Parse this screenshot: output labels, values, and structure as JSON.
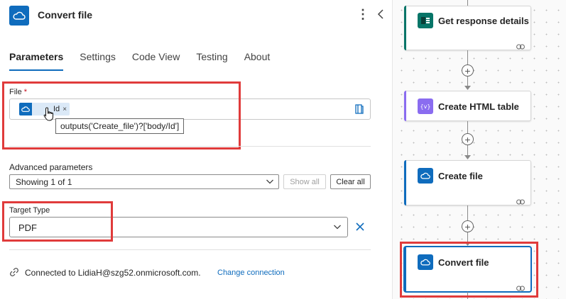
{
  "panel": {
    "title": "Convert file",
    "tabs": [
      {
        "label": "Parameters",
        "active": true
      },
      {
        "label": "Settings",
        "active": false
      },
      {
        "label": "Code View",
        "active": false
      },
      {
        "label": "Testing",
        "active": false
      },
      {
        "label": "About",
        "active": false
      }
    ],
    "file_field": {
      "label": "File",
      "required_mark": "*",
      "token_text": "Id",
      "token_remove": "×",
      "tooltip": "outputs('Create_file')?['body/Id']"
    },
    "advanced": {
      "label": "Advanced parameters",
      "selected": "Showing 1 of 1",
      "show_all": "Show all",
      "clear_all": "Clear all"
    },
    "target_type": {
      "label": "Target Type",
      "value": "PDF"
    },
    "connection": {
      "text": "Connected to LidiaH@szg52.onmicrosoft.com.",
      "link": "Change connection"
    }
  },
  "flow": {
    "add_symbol": "+",
    "cards": [
      {
        "title": "Get response details",
        "icon": "forms-icon",
        "color": "#077568"
      },
      {
        "title": "Create HTML table",
        "icon": "data-operation-icon",
        "color": "#8a6cf0"
      },
      {
        "title": "Create file",
        "icon": "onedrive-icon",
        "color": "#0f6cbd"
      },
      {
        "title": "Convert file",
        "icon": "onedrive-icon",
        "color": "#0f6cbd",
        "selected": true
      }
    ]
  },
  "colors": {
    "accent": "#0f6cbd",
    "highlight": "#e03b3b",
    "required": "#c50f1f"
  }
}
